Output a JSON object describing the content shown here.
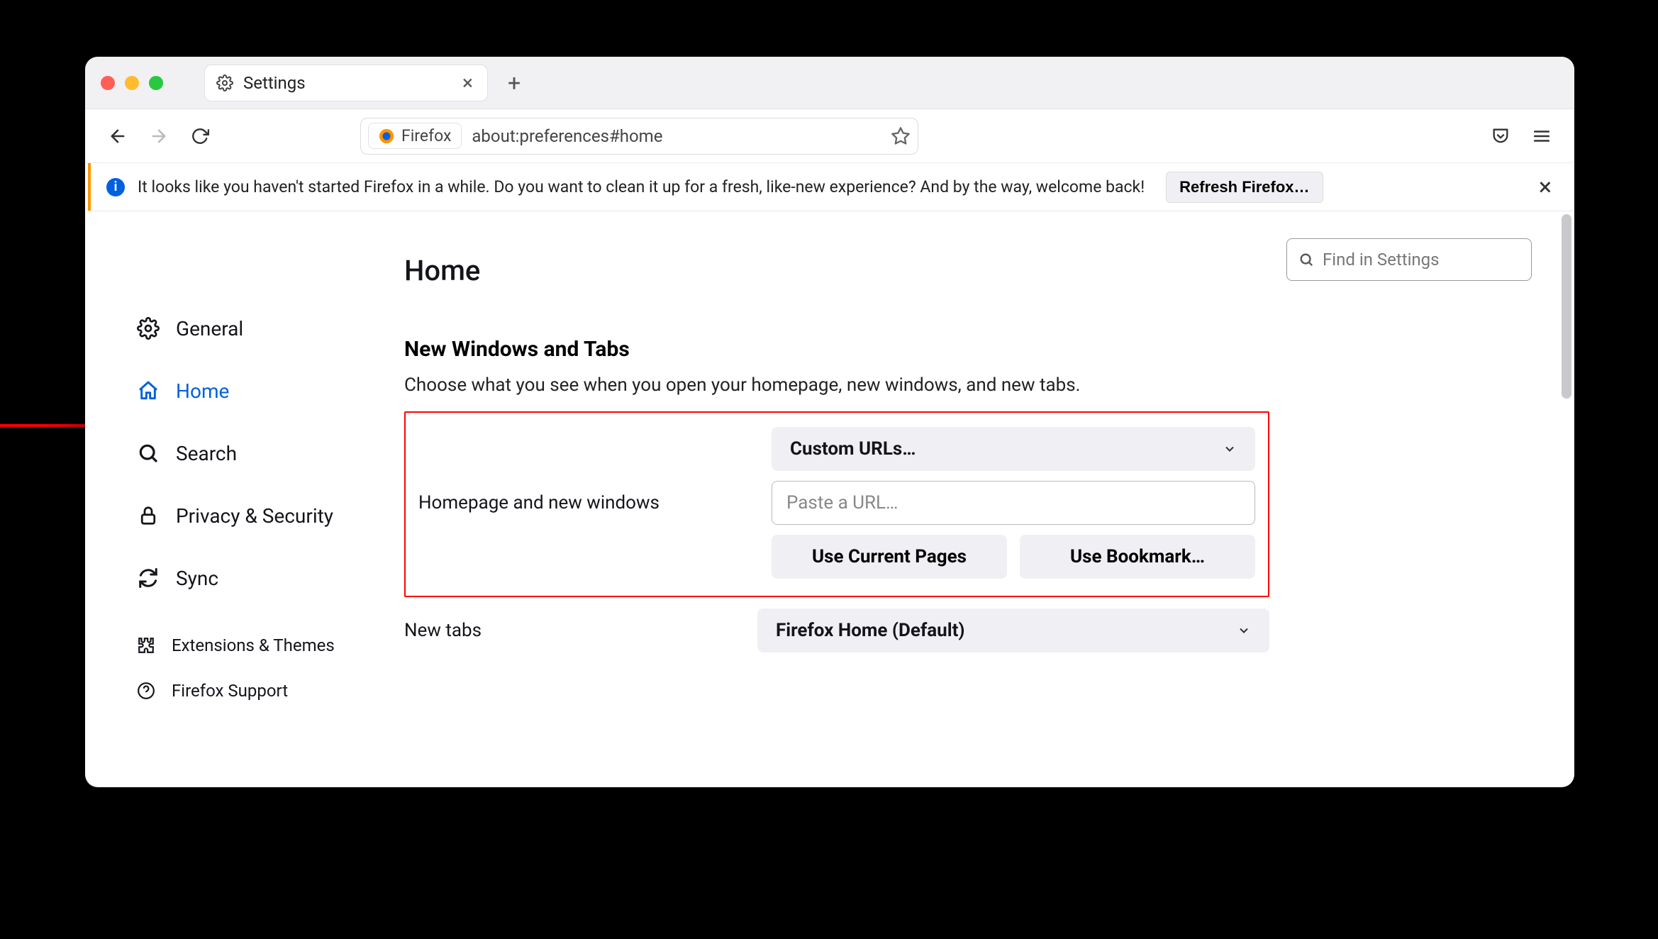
{
  "tab": {
    "title": "Settings"
  },
  "url": {
    "scheme_label": "Firefox",
    "address": "about:preferences#home"
  },
  "infobar": {
    "message": "It looks like you haven't started Firefox in a while. Do you want to clean it up for a fresh, like-new experience? And by the way, welcome back!",
    "button": "Refresh Firefox…"
  },
  "search": {
    "placeholder": "Find in Settings"
  },
  "sidebar": {
    "items": [
      {
        "label": "General"
      },
      {
        "label": "Home"
      },
      {
        "label": "Search"
      },
      {
        "label": "Privacy & Security"
      },
      {
        "label": "Sync"
      }
    ],
    "footer": [
      {
        "label": "Extensions & Themes"
      },
      {
        "label": "Firefox Support"
      }
    ]
  },
  "page": {
    "title": "Home",
    "section_title": "New Windows and Tabs",
    "section_desc": "Choose what you see when you open your homepage, new windows, and new tabs.",
    "homepage_label": "Homepage and new windows",
    "homepage_dropdown": "Custom URLs…",
    "homepage_placeholder": "Paste a URL…",
    "use_current": "Use Current Pages",
    "use_bookmark": "Use Bookmark…",
    "newtabs_label": "New tabs",
    "newtabs_dropdown": "Firefox Home (Default)"
  }
}
